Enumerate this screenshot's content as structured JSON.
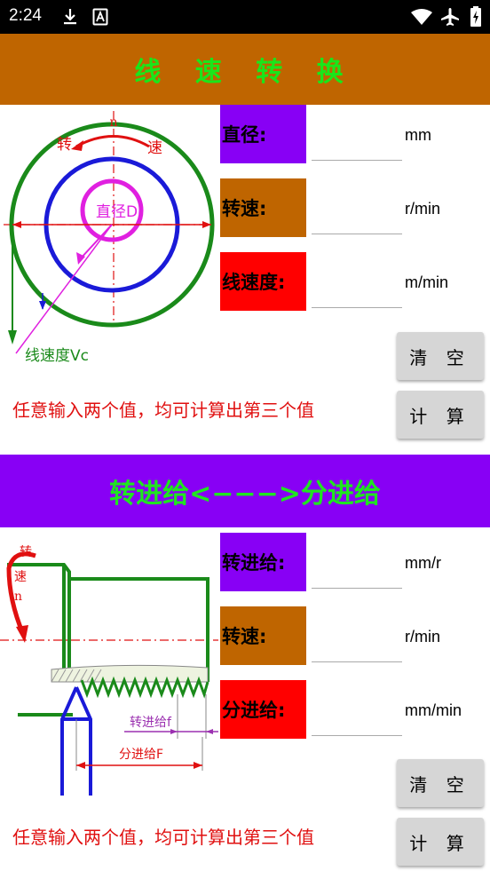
{
  "status": {
    "time": "2:24"
  },
  "colors": {
    "banner1_bg": "#BF6500",
    "banner2_bg": "#8800F5",
    "banner_text": "#1AE61A",
    "purple": "#8800F5",
    "brown": "#BF6500",
    "red": "#FF0000",
    "hint": "#E01010"
  },
  "section1": {
    "title": "线 速 转 换",
    "diagram": {
      "label_n": "n",
      "label_zhuan": "转",
      "label_su": "速",
      "label_diameter": "直径D",
      "label_vc": "线速度Vc"
    },
    "fields": [
      {
        "label": "直径:",
        "unit": "mm",
        "value": ""
      },
      {
        "label": "转速:",
        "unit": "r/min",
        "value": ""
      },
      {
        "label": "线速度:",
        "unit": "m/min",
        "value": ""
      }
    ],
    "clear_label": "清 空",
    "calc_label": "计 算",
    "hint": "任意输入两个值，均可计算出第三个值"
  },
  "section2": {
    "title": "转进给<−−−>分进给",
    "diagram": {
      "label_zhuan": "转",
      "label_su": "速",
      "label_n": "n",
      "label_feed_rev": "转进给f",
      "label_feed_min": "分进给F"
    },
    "fields": [
      {
        "label": "转进给:",
        "unit": "mm/r",
        "value": ""
      },
      {
        "label": "转速:",
        "unit": "r/min",
        "value": ""
      },
      {
        "label": "分进给:",
        "unit": "mm/min",
        "value": ""
      }
    ],
    "clear_label": "清 空",
    "calc_label": "计 算",
    "hint": "任意输入两个值，均可计算出第三个值"
  }
}
